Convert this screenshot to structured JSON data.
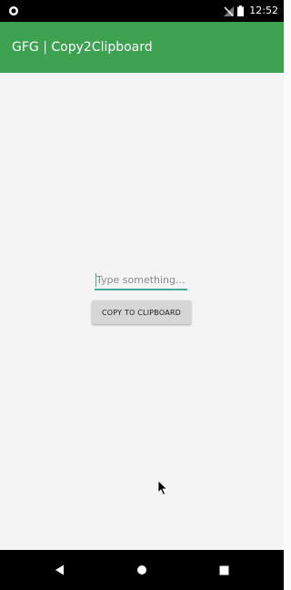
{
  "status_bar": {
    "time": "12:52",
    "icons": [
      "record-icon",
      "no-signal-icon",
      "battery-icon"
    ]
  },
  "app_bar": {
    "title": "GFG | Copy2Clipboard",
    "background_color": "#3da250"
  },
  "main": {
    "input": {
      "value": "",
      "placeholder": "Type something...",
      "accent_color": "#45a89a"
    },
    "copy_button": {
      "label": "COPY TO CLIPBOARD"
    }
  },
  "nav_bar": {
    "buttons": [
      "back-icon",
      "home-icon",
      "recents-icon"
    ]
  }
}
